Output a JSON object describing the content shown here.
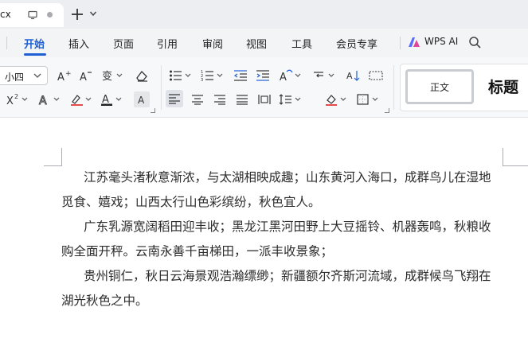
{
  "tabbar": {
    "doc_tab_title": "cx",
    "icons": [
      "monitor-icon",
      "unsaved-dot-icon",
      "plus-icon",
      "chevron-down-icon"
    ]
  },
  "menu": {
    "items": [
      {
        "label": "开始",
        "active": true
      },
      {
        "label": "插入"
      },
      {
        "label": "页面"
      },
      {
        "label": "引用"
      },
      {
        "label": "审阅"
      },
      {
        "label": "视图"
      },
      {
        "label": "工具"
      },
      {
        "label": "会员专享"
      }
    ],
    "ai_label": "WPS AI",
    "accent": "#1f5fd6"
  },
  "ribbon": {
    "font_size": "小四",
    "styles": {
      "normal": "正文",
      "heading": "标题"
    }
  },
  "document": {
    "paragraphs": [
      {
        "line1": "江苏毫头渚秋意渐浓，与太湖相映成趣；山东黄河入海口，成群鸟儿在湿地",
        "line2": "觅食、嬉戏；山西太行山色彩缤纷，秋色宜人。"
      },
      {
        "line1": "广东乳源宽阔稻田迎丰收；黑龙江黑河田野上大豆摇铃、机器轰鸣，秋粮收",
        "line2": "购全面开秤。云南永善千亩梯田，一派丰收景象；"
      },
      {
        "line1": "贵州铜仁，秋日云海景观浩瀚缥缈；新疆额尔齐斯河流域，成群候鸟飞翔在",
        "line2": "湖光秋色之中。"
      }
    ]
  }
}
